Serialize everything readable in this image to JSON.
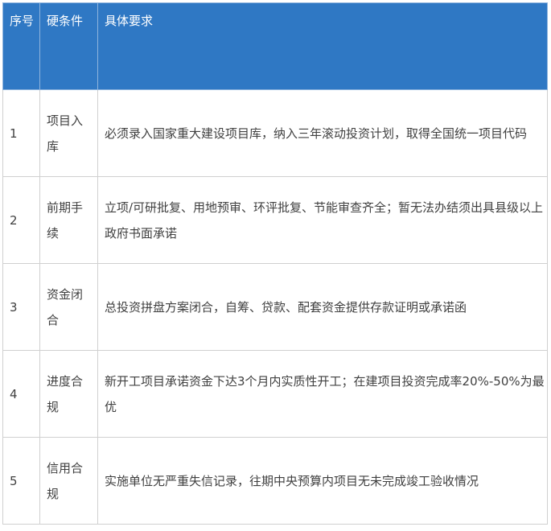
{
  "table": {
    "headers": [
      "序号",
      "硬条件",
      "具体要求"
    ],
    "rows": [
      {
        "no": "1",
        "cond": "项目入库",
        "req": "必须录入国家重大建设项目库，纳入三年滚动投资计划，取得全国统一项目代码"
      },
      {
        "no": "2",
        "cond": "前期手续",
        "req": "立项/可研批复、用地预审、环评批复、节能审查齐全；暂无法办结须出具县级以上政府书面承诺"
      },
      {
        "no": "3",
        "cond": "资金闭合",
        "req": "总投资拼盘方案闭合，自筹、贷款、配套资金提供存款证明或承诺函"
      },
      {
        "no": "4",
        "cond": "进度合规",
        "req": "新开工项目承诺资金下达3个月内实质性开工；在建项目投资完成率20%-50%为最优"
      },
      {
        "no": "5",
        "cond": "信用合规",
        "req": "实施单位无严重失信记录，往期中央预算内项目无未完成竣工验收情况"
      }
    ]
  },
  "colors": {
    "header_bg": "#2f78c4",
    "border": "#d0d0d0",
    "text": "#404040"
  }
}
